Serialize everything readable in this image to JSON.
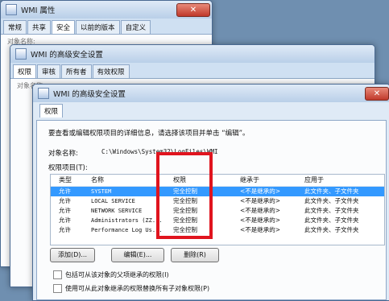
{
  "win1": {
    "title": "WMI 属性",
    "tabs": [
      "常规",
      "共享",
      "安全",
      "以前的版本",
      "自定义"
    ],
    "active_tab": 2,
    "obj_label": "对象名称:"
  },
  "win2": {
    "title": "WMI 的高级安全设置",
    "tabs": [
      "权限",
      "审核",
      "所有者",
      "有效权限"
    ],
    "obj_label": "对象名称:"
  },
  "win3": {
    "title": "WMI 的高级安全设置",
    "tab": "权限",
    "instructions": "要查看或编辑权限项目的详细信息，请选择该项目并单击 “编辑”。",
    "object_name_label": "对象名称:",
    "object_name_value": "C:\\Windows\\System32\\LogFiles\\WMI",
    "entries_label": "权限项目(T):",
    "columns": [
      "类型",
      "名称",
      "权限",
      "继承于",
      "应用于"
    ],
    "rows": [
      {
        "type": "允许",
        "name": "SYSTEM",
        "perm": "完全控制",
        "inherit": "<不是继承的>",
        "apply": "此文件夹、子文件夹"
      },
      {
        "type": "允许",
        "name": "LOCAL SERVICE",
        "perm": "完全控制",
        "inherit": "<不是继承的>",
        "apply": "此文件夹、子文件夹"
      },
      {
        "type": "允许",
        "name": "NETWORK SERVICE",
        "perm": "完全控制",
        "inherit": "<不是继承的>",
        "apply": "此文件夹、子文件夹"
      },
      {
        "type": "允许",
        "name": "Administrators (ZZ...",
        "perm": "完全控制",
        "inherit": "<不是继承的>",
        "apply": "此文件夹、子文件夹"
      },
      {
        "type": "允许",
        "name": "Performance Log Us...",
        "perm": "完全控制",
        "inherit": "<不是继承的>",
        "apply": "此文件夹、子文件夹"
      }
    ],
    "selected_row": 0,
    "buttons": {
      "add": "添加(D)...",
      "edit": "编辑(E)...",
      "remove": "删除(R)"
    },
    "checkbox1": "包括可从该对象的父项继承的权限(I)",
    "checkbox2": "使用可从此对象继承的权限替换所有子对象权限(P)"
  },
  "colors": {
    "highlight": "#3399ff",
    "annotation": "#e0141e",
    "close": "#c0392b"
  }
}
